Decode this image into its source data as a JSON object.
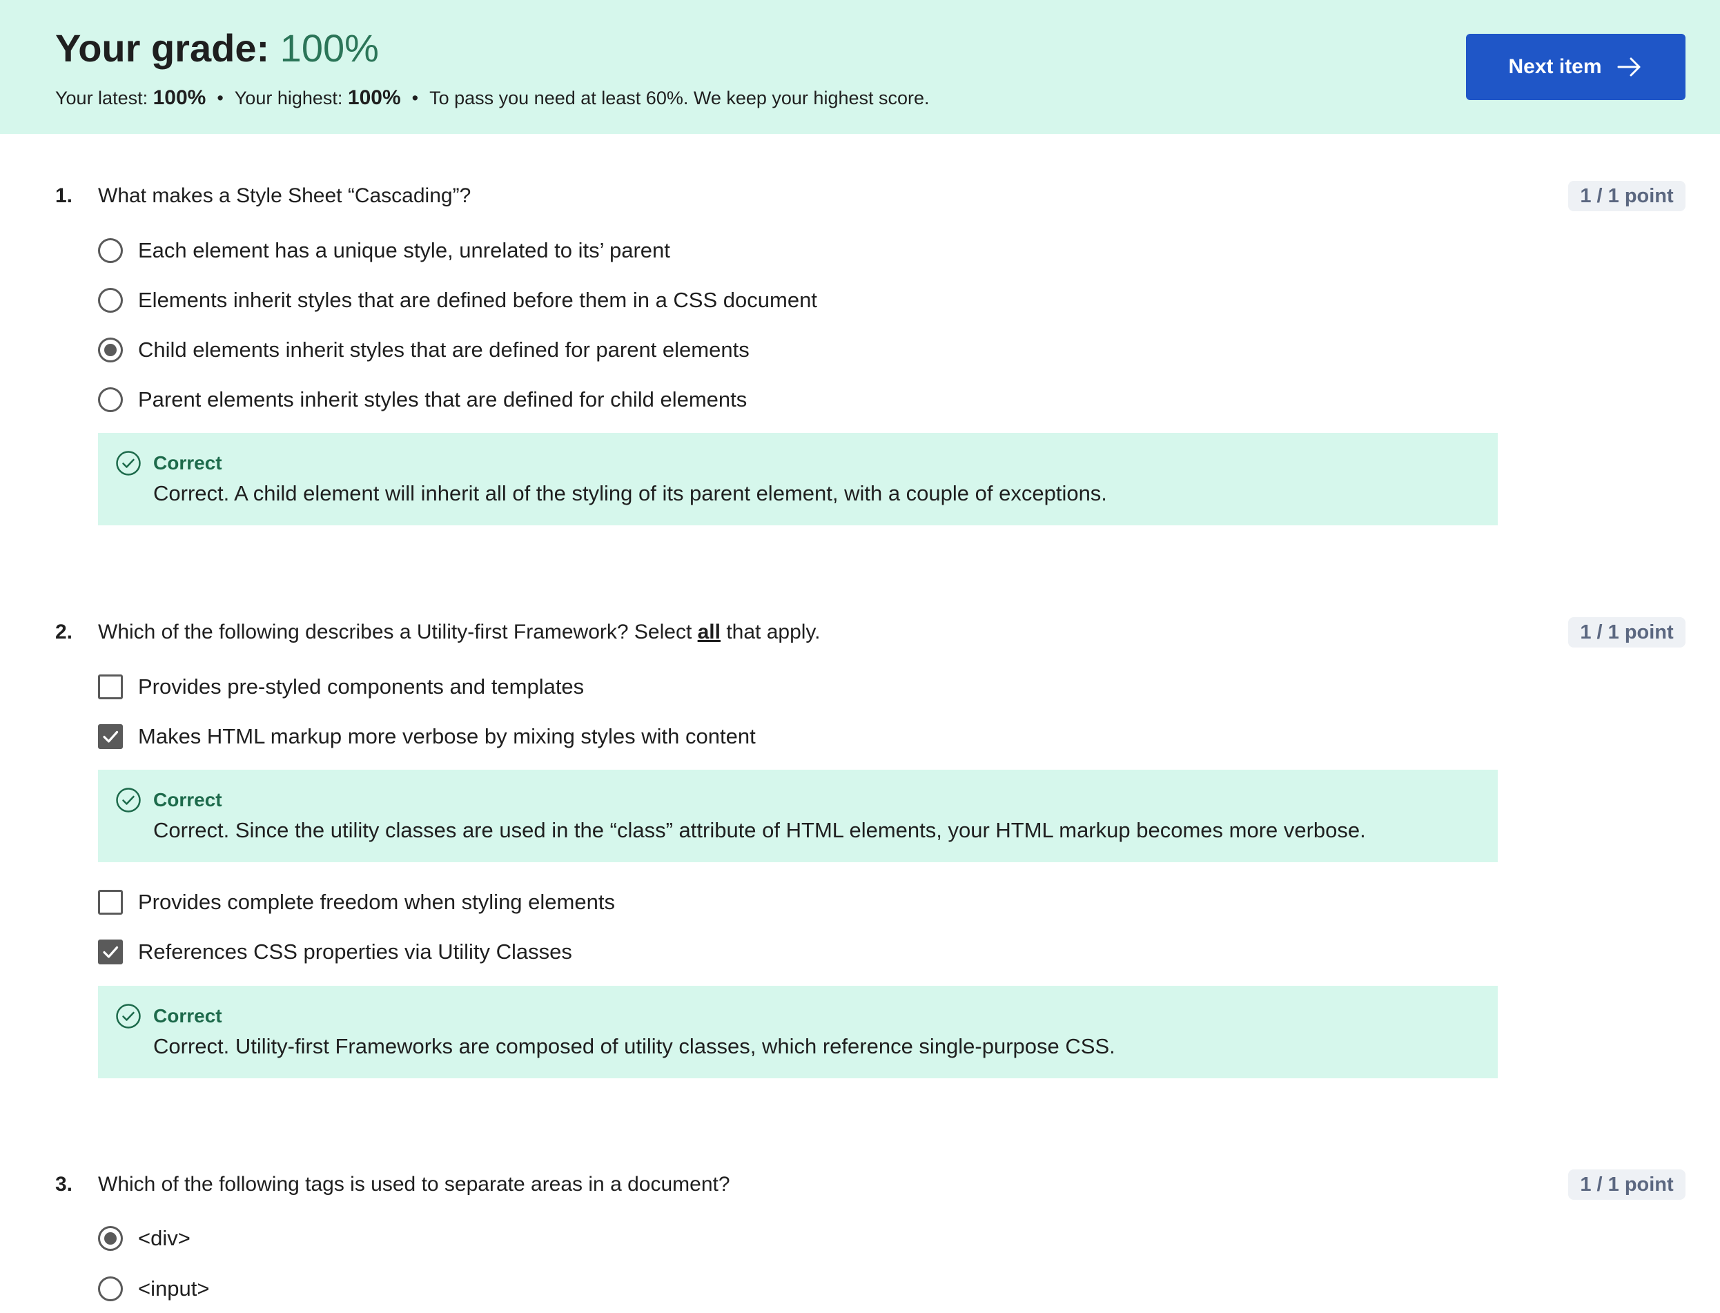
{
  "header": {
    "grade_label": "Your grade: ",
    "grade_value": "100%",
    "latest_label": "Your latest: ",
    "latest_value": "100%",
    "separator": "•",
    "highest_label": "Your highest: ",
    "highest_value": "100%",
    "pass_note": "To pass you need at least 60%. We keep your highest score.",
    "next_button": "Next item",
    "next_icon": "arrow-right-icon"
  },
  "colors": {
    "header_bg": "#d6f7ec",
    "grade_green": "#2b7558",
    "button_blue": "#1f56c7",
    "feedback_bg": "#d6f7ec",
    "feedback_title": "#1d6a4b"
  },
  "questions": [
    {
      "number": "1.",
      "text": "What makes a Style Sheet “Cascading”?",
      "points": "1 / 1 point",
      "type": "radio",
      "options": [
        {
          "label": "Each element has a unique style, unrelated to its’ parent",
          "selected": false
        },
        {
          "label": "Elements inherit styles that are defined before them in a CSS document",
          "selected": false
        },
        {
          "label": "Child elements inherit styles that are defined for parent elements",
          "selected": true
        },
        {
          "label": "Parent elements inherit styles that are defined for child elements",
          "selected": false
        }
      ],
      "feedback": [
        {
          "title": "Correct",
          "text": "Correct. A child element will inherit all of the styling of its parent element, with a couple of exceptions."
        }
      ]
    },
    {
      "number": "2.",
      "text_before": "Which of the following describes a Utility-first Framework? Select ",
      "text_emphasis": "all",
      "text_after": " that apply.",
      "points": "1 / 1 point",
      "type": "checkbox",
      "options": [
        {
          "label": "Provides pre-styled components and templates",
          "selected": false
        },
        {
          "label": "Makes HTML markup more verbose by mixing styles with content",
          "selected": true
        },
        {
          "label": "Provides complete freedom when styling elements",
          "selected": false
        },
        {
          "label": "References CSS properties via Utility Classes",
          "selected": true
        }
      ],
      "feedback": [
        {
          "title": "Correct",
          "text": "Correct. Since the utility classes are used in the “class” attribute of HTML elements, your HTML markup becomes more verbose."
        },
        {
          "title": "Correct",
          "text": "Correct. Utility-first Frameworks are composed of utility classes, which reference single-purpose CSS."
        }
      ]
    },
    {
      "number": "3.",
      "text": "Which of the following tags is used to separate areas in a document?",
      "points": "1 / 1 point",
      "type": "radio",
      "options": [
        {
          "label": "<div>",
          "selected": true
        },
        {
          "label": "<input>",
          "selected": false
        }
      ]
    }
  ]
}
